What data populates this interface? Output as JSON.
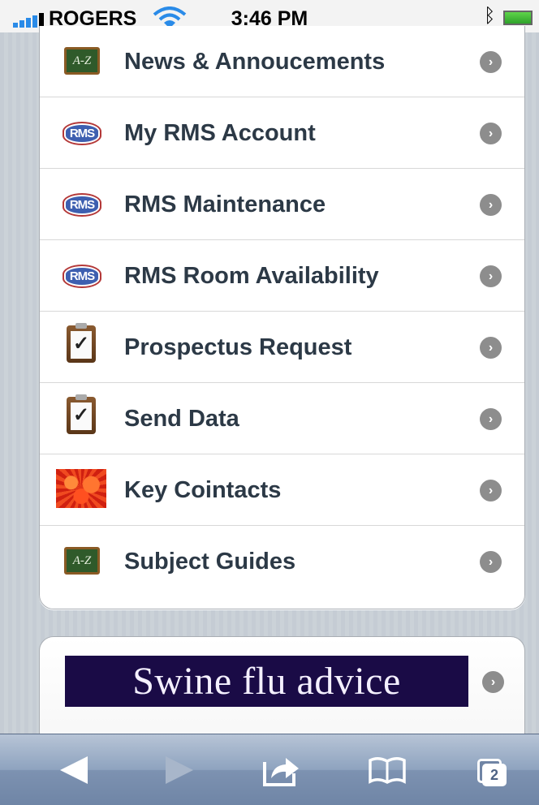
{
  "status_bar": {
    "carrier": "ROGERS",
    "time": "3:46 PM",
    "icons": [
      "signal-bars-icon",
      "wifi-icon",
      "bluetooth-icon",
      "battery-charging-icon"
    ]
  },
  "menu": {
    "items": [
      {
        "label": "News & Annoucements",
        "icon": "az-chalkboard-icon"
      },
      {
        "label": "My RMS Account",
        "icon": "rms-logo-icon"
      },
      {
        "label": "RMS Maintenance",
        "icon": "rms-logo-icon"
      },
      {
        "label": "RMS Room Availability",
        "icon": "rms-logo-icon"
      },
      {
        "label": "Prospectus Request",
        "icon": "clipboard-check-icon"
      },
      {
        "label": "Send Data",
        "icon": "clipboard-check-icon"
      },
      {
        "label": "Key Cointacts",
        "icon": "red-flower-icon"
      },
      {
        "label": "Subject Guides",
        "icon": "az-chalkboard-icon"
      }
    ],
    "chevron_icon": "chevron-right-icon",
    "icon_text": {
      "az": "A-Z",
      "rms": "RMS"
    }
  },
  "banner": {
    "text": "Swine flu advice"
  },
  "toolbar": {
    "tab_count": "2",
    "buttons": [
      "back-icon",
      "forward-icon",
      "share-icon",
      "bookmarks-icon",
      "tabs-icon"
    ]
  },
  "colors": {
    "label_text": "#2c3946",
    "banner_background": "#1a0b46",
    "toolbar_blue": "#7d92b1"
  }
}
